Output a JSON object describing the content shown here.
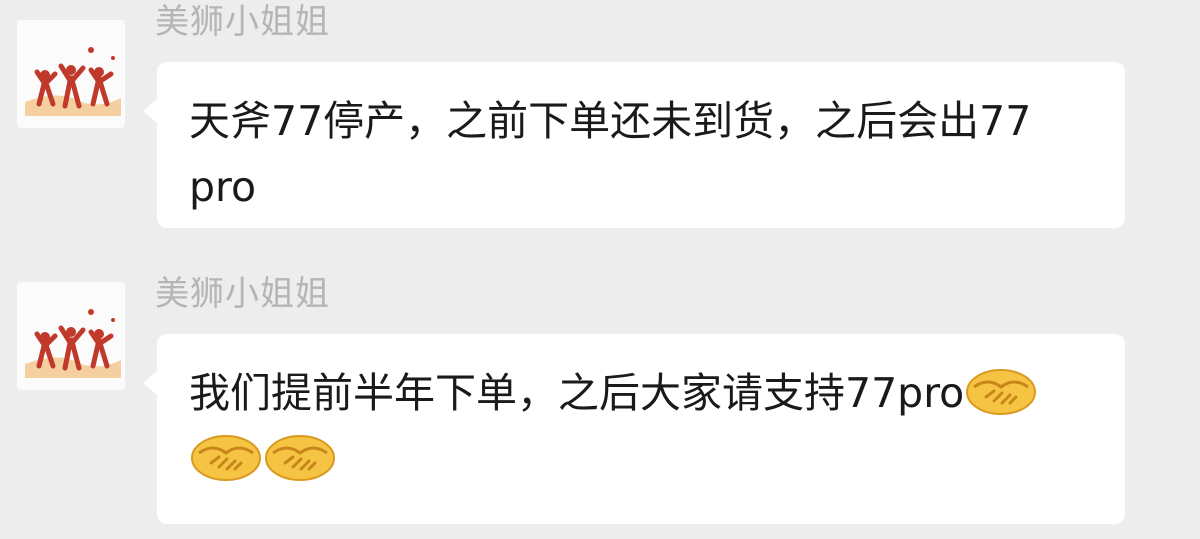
{
  "messages": [
    {
      "sender": "美狮小姐姐",
      "lines": [
        "天斧77停产，之前下单还未到货，之后会出77",
        "pro"
      ]
    },
    {
      "sender": "美狮小姐姐",
      "line1": "我们提前半年下单，之后大家请支持77pro",
      "emoji_count": 3,
      "emoji": "handshake-emoji"
    }
  ],
  "colors": {
    "background": "#ededed",
    "bubble": "#ffffff",
    "sender_name": "#b5b5b5",
    "text": "#1a1a1a"
  }
}
